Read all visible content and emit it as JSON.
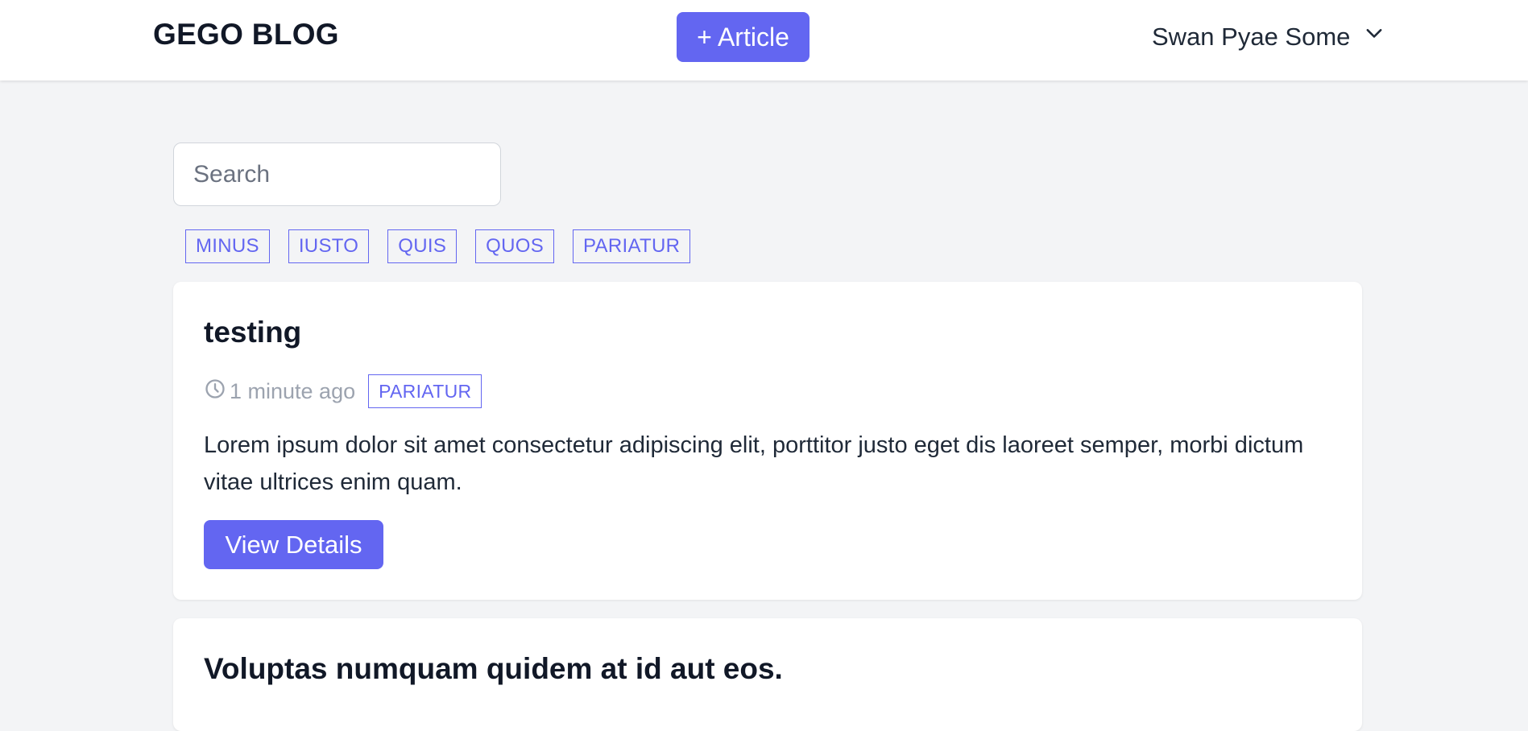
{
  "navbar": {
    "brand": "GEGO BLOG",
    "add_article_label": "+ Article",
    "user_name": "Swan Pyae Some"
  },
  "search": {
    "placeholder": "Search",
    "value": ""
  },
  "tags": [
    "MINUS",
    "IUSTO",
    "QUIS",
    "QUOS",
    "PARIATUR"
  ],
  "articles": [
    {
      "title": "testing",
      "time": "1 minute ago",
      "tag": "PARIATUR",
      "excerpt": "Lorem ipsum dolor sit amet consectetur adipiscing elit, porttitor justo eget dis laoreet semper, morbi dictum vitae ultrices enim quam.",
      "button_label": "View Details"
    },
    {
      "title": "Voluptas numquam quidem at id aut eos."
    }
  ],
  "icons": {
    "user_menu": "chevron-down-icon",
    "time": "clock-icon"
  },
  "colors": {
    "accent": "#6366f1",
    "background": "#f3f4f6",
    "card": "#ffffff",
    "muted_text": "#9ca3af"
  }
}
